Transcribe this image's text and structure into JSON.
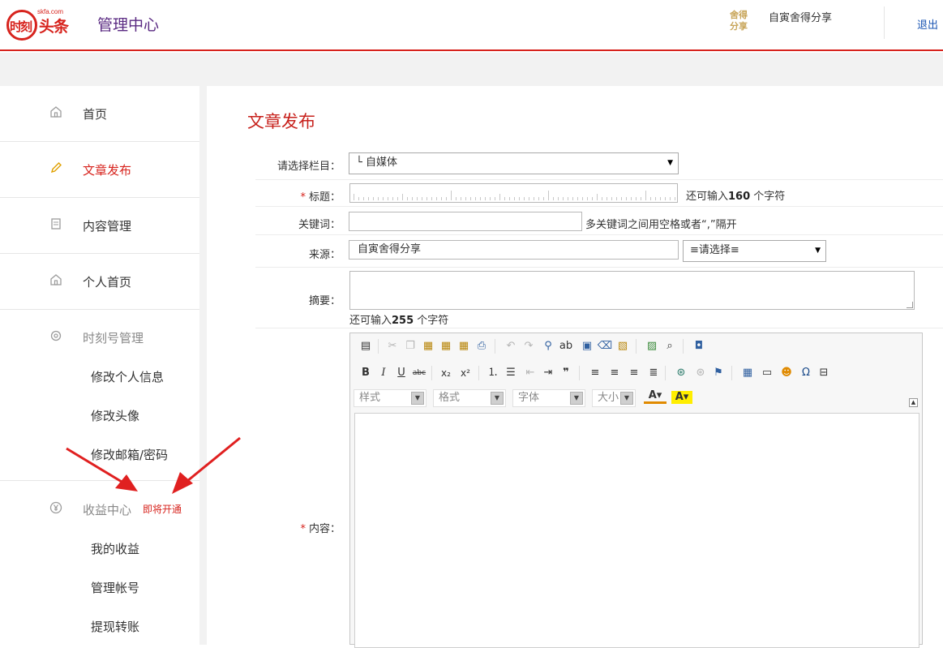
{
  "header": {
    "logo_text": "时刻头条",
    "logo_url": "skfa.com",
    "title": "管理中心",
    "user_logo": "舍得分享",
    "user_name": "自寅舍得分享",
    "logout": "退出"
  },
  "sidebar": {
    "items": [
      {
        "label": "首页",
        "icon": "home-icon"
      },
      {
        "label": "文章发布",
        "icon": "pencil-icon"
      },
      {
        "label": "内容管理",
        "icon": "content-icon"
      },
      {
        "label": "个人首页",
        "icon": "home-icon"
      }
    ],
    "group_account": {
      "label": "时刻号管理",
      "icon": "gear-icon",
      "subs": [
        "修改个人信息",
        "修改头像",
        "修改邮箱/密码"
      ]
    },
    "group_income": {
      "label": "收益中心",
      "icon": "yen-icon",
      "badge": "即将开通",
      "subs": [
        "我的收益",
        "管理帐号",
        "提现转账"
      ]
    }
  },
  "main": {
    "title": "文章发布",
    "category": {
      "label": "请选择栏目：",
      "value": "└ 自媒体"
    },
    "title_field": {
      "required": "*",
      "label": "标题：",
      "hint_prefix": "还可输入",
      "hint_count": "160",
      "hint_suffix": "个字符"
    },
    "keywords": {
      "label": "关键词：",
      "hint": "多关键词之间用空格或者“,”隔开"
    },
    "source": {
      "label": "来源：",
      "value": "自寅舍得分享",
      "select": "≡请选择≡"
    },
    "summary": {
      "label": "摘要：",
      "hint_prefix": "还可输入",
      "hint_count": "255",
      "hint_suffix": "个字符"
    },
    "content": {
      "required": "*",
      "label": "内容："
    },
    "editor": {
      "combos": [
        "样式",
        "格式",
        "字体",
        "大小"
      ]
    }
  }
}
